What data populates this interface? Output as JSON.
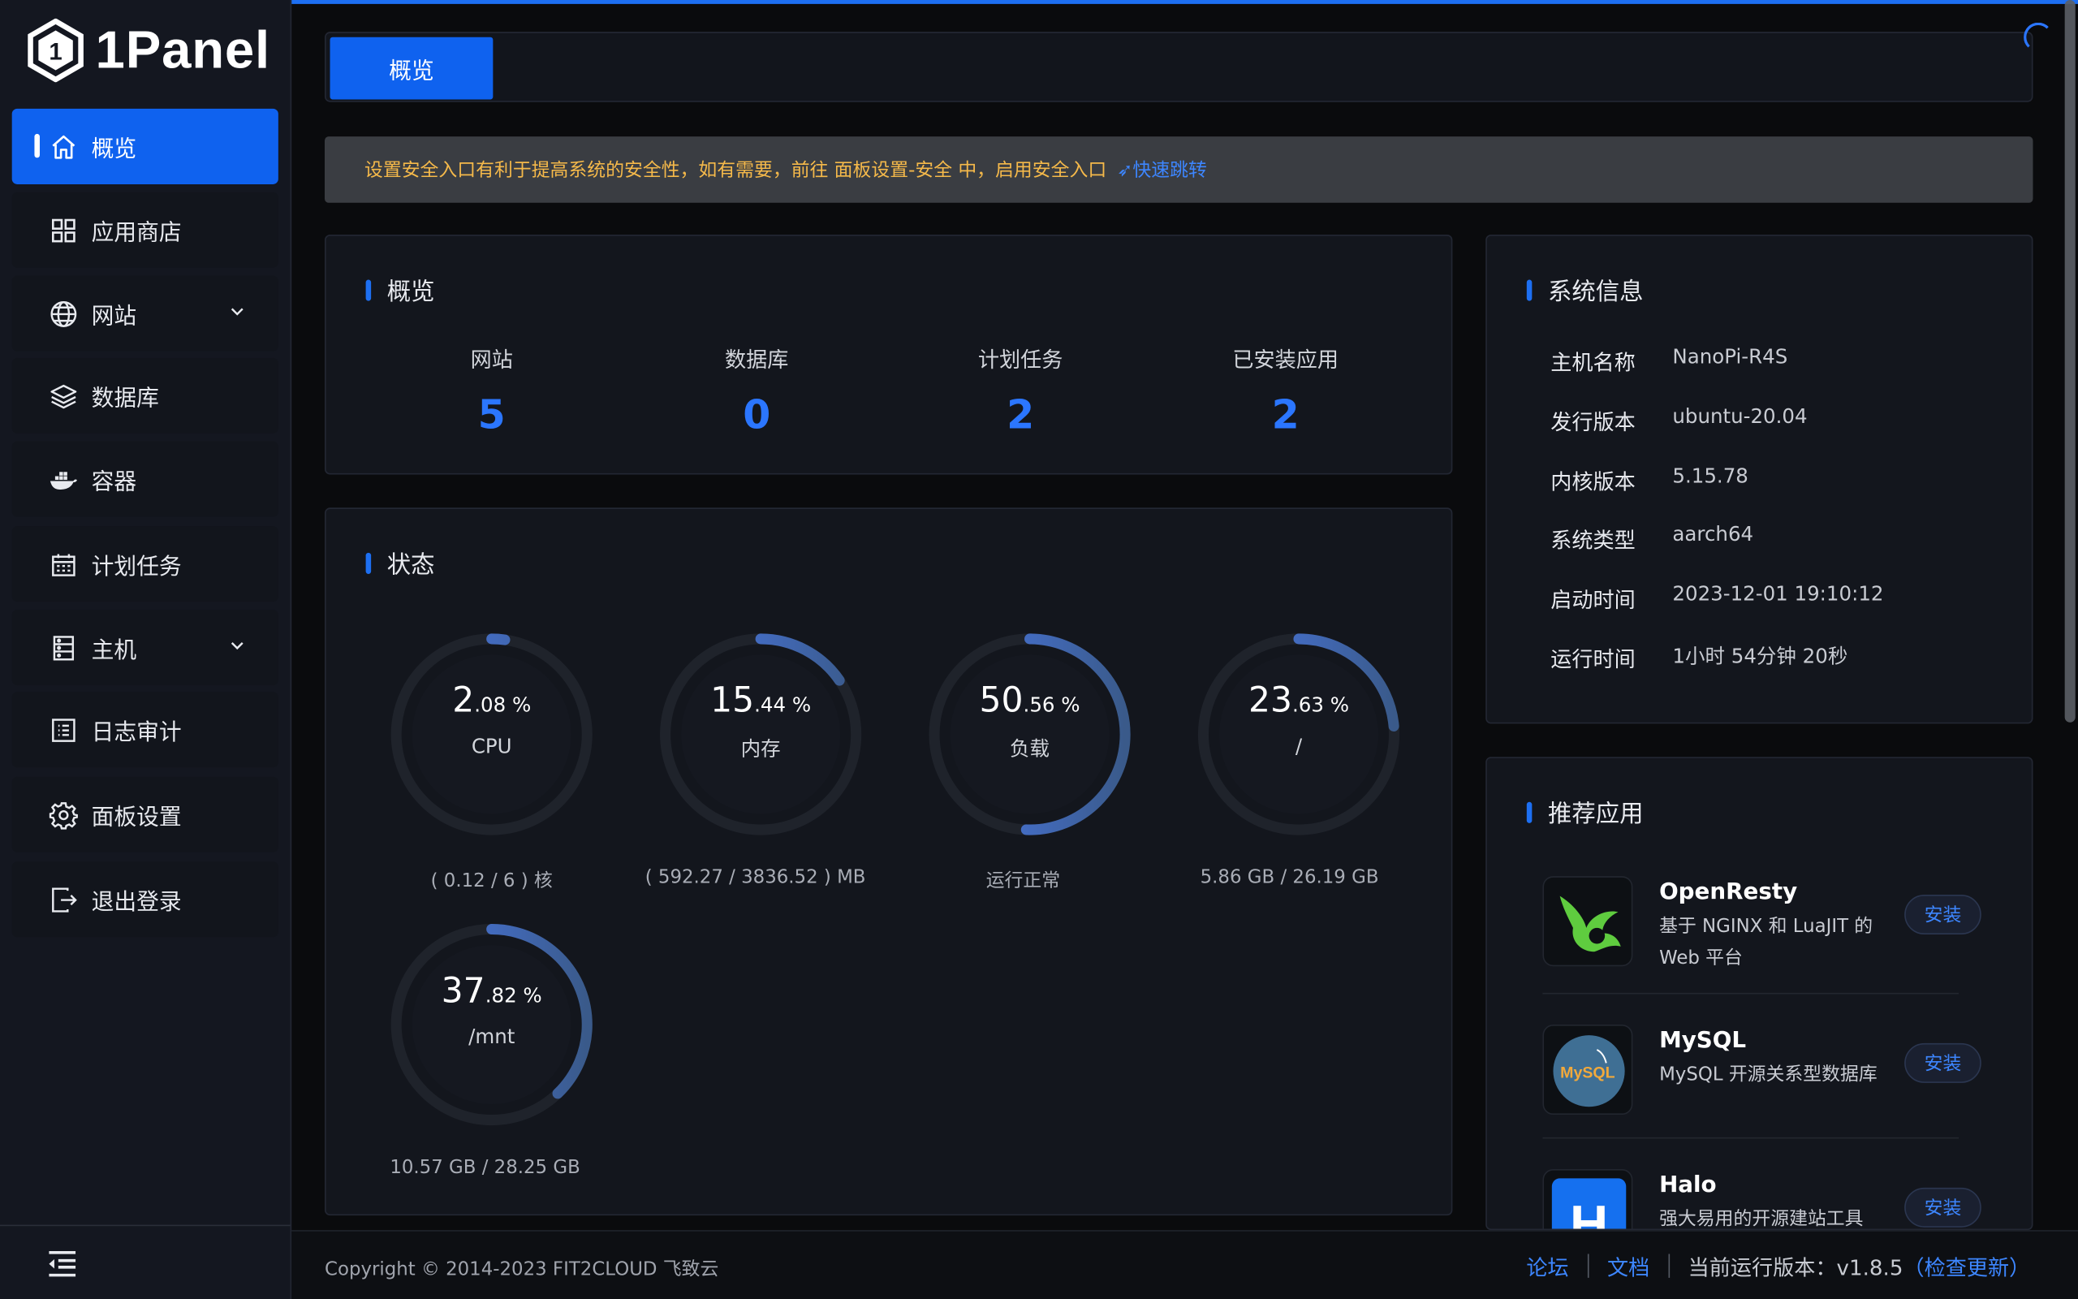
{
  "app": {
    "logo_text": "1Panel"
  },
  "sidebar": {
    "items": [
      {
        "label": "概览",
        "icon": "home-icon",
        "active": true
      },
      {
        "label": "应用商店",
        "icon": "grid-icon"
      },
      {
        "label": "网站",
        "icon": "globe-icon",
        "expandable": true
      },
      {
        "label": "数据库",
        "icon": "layers-icon"
      },
      {
        "label": "容器",
        "icon": "docker-icon"
      },
      {
        "label": "计划任务",
        "icon": "calendar-icon"
      },
      {
        "label": "主机",
        "icon": "server-icon",
        "expandable": true
      },
      {
        "label": "日志审计",
        "icon": "log-icon"
      },
      {
        "label": "面板设置",
        "icon": "gear-icon"
      },
      {
        "label": "退出登录",
        "icon": "logout-icon"
      }
    ]
  },
  "tabs": {
    "active_label": "概览"
  },
  "alert": {
    "message": "设置安全入口有利于提高系统的安全性，如有需要，前往 面板设置-安全 中，启用安全入口",
    "link": "快速跳转"
  },
  "overview": {
    "title": "概览",
    "items": [
      {
        "label": "网站",
        "value": "5"
      },
      {
        "label": "数据库",
        "value": "0"
      },
      {
        "label": "计划任务",
        "value": "2"
      },
      {
        "label": "已安装应用",
        "value": "2"
      }
    ]
  },
  "status": {
    "title": "状态",
    "gauges": [
      {
        "int": "2",
        "dec": ".08 %",
        "name": "CPU",
        "sub": "( 0.12 / 6 ) 核",
        "percent": 2.08
      },
      {
        "int": "15",
        "dec": ".44 %",
        "name": "内存",
        "sub": "( 592.27 / 3836.52 ) MB",
        "percent": 15.44
      },
      {
        "int": "50",
        "dec": ".56 %",
        "name": "负载",
        "sub": "运行正常",
        "percent": 50.56
      },
      {
        "int": "23",
        "dec": ".63 %",
        "name": "/",
        "sub": "5.86 GB / 26.19 GB",
        "percent": 23.63
      },
      {
        "int": "37",
        "dec": ".82 %",
        "name": "/mnt",
        "sub": "10.57 GB / 28.25 GB",
        "percent": 37.82
      }
    ]
  },
  "system_info": {
    "title": "系统信息",
    "rows": [
      {
        "label": "主机名称",
        "value": "NanoPi-R4S"
      },
      {
        "label": "发行版本",
        "value": "ubuntu-20.04"
      },
      {
        "label": "内核版本",
        "value": "5.15.78"
      },
      {
        "label": "系统类型",
        "value": "aarch64"
      },
      {
        "label": "启动时间",
        "value": "2023-12-01 19:10:12"
      },
      {
        "label": "运行时间",
        "value": "1小时 54分钟 20秒"
      }
    ]
  },
  "recommended": {
    "title": "推荐应用",
    "apps": [
      {
        "name": "OpenResty",
        "desc": "基于 NGINX 和 LuaJIT 的 Web 平台",
        "button": "安装",
        "icon": "openresty-icon"
      },
      {
        "name": "MySQL",
        "desc": "MySQL 开源关系型数据库",
        "button": "安装",
        "icon": "mysql-icon",
        "icon_text": "MySQL"
      },
      {
        "name": "Halo",
        "desc": "强大易用的开源建站工具",
        "button": "安装",
        "icon": "halo-icon",
        "icon_text": "H"
      }
    ]
  },
  "footer": {
    "copyright": "Copyright © 2014-2023 FIT2CLOUD 飞致云",
    "forum": "论坛",
    "docs": "文档",
    "version": "当前运行版本：v1.8.5",
    "check_update": "（检查更新）"
  },
  "colors": {
    "accent": "#0f62ef",
    "link": "#3d86ff",
    "warning": "#f5b94a"
  }
}
